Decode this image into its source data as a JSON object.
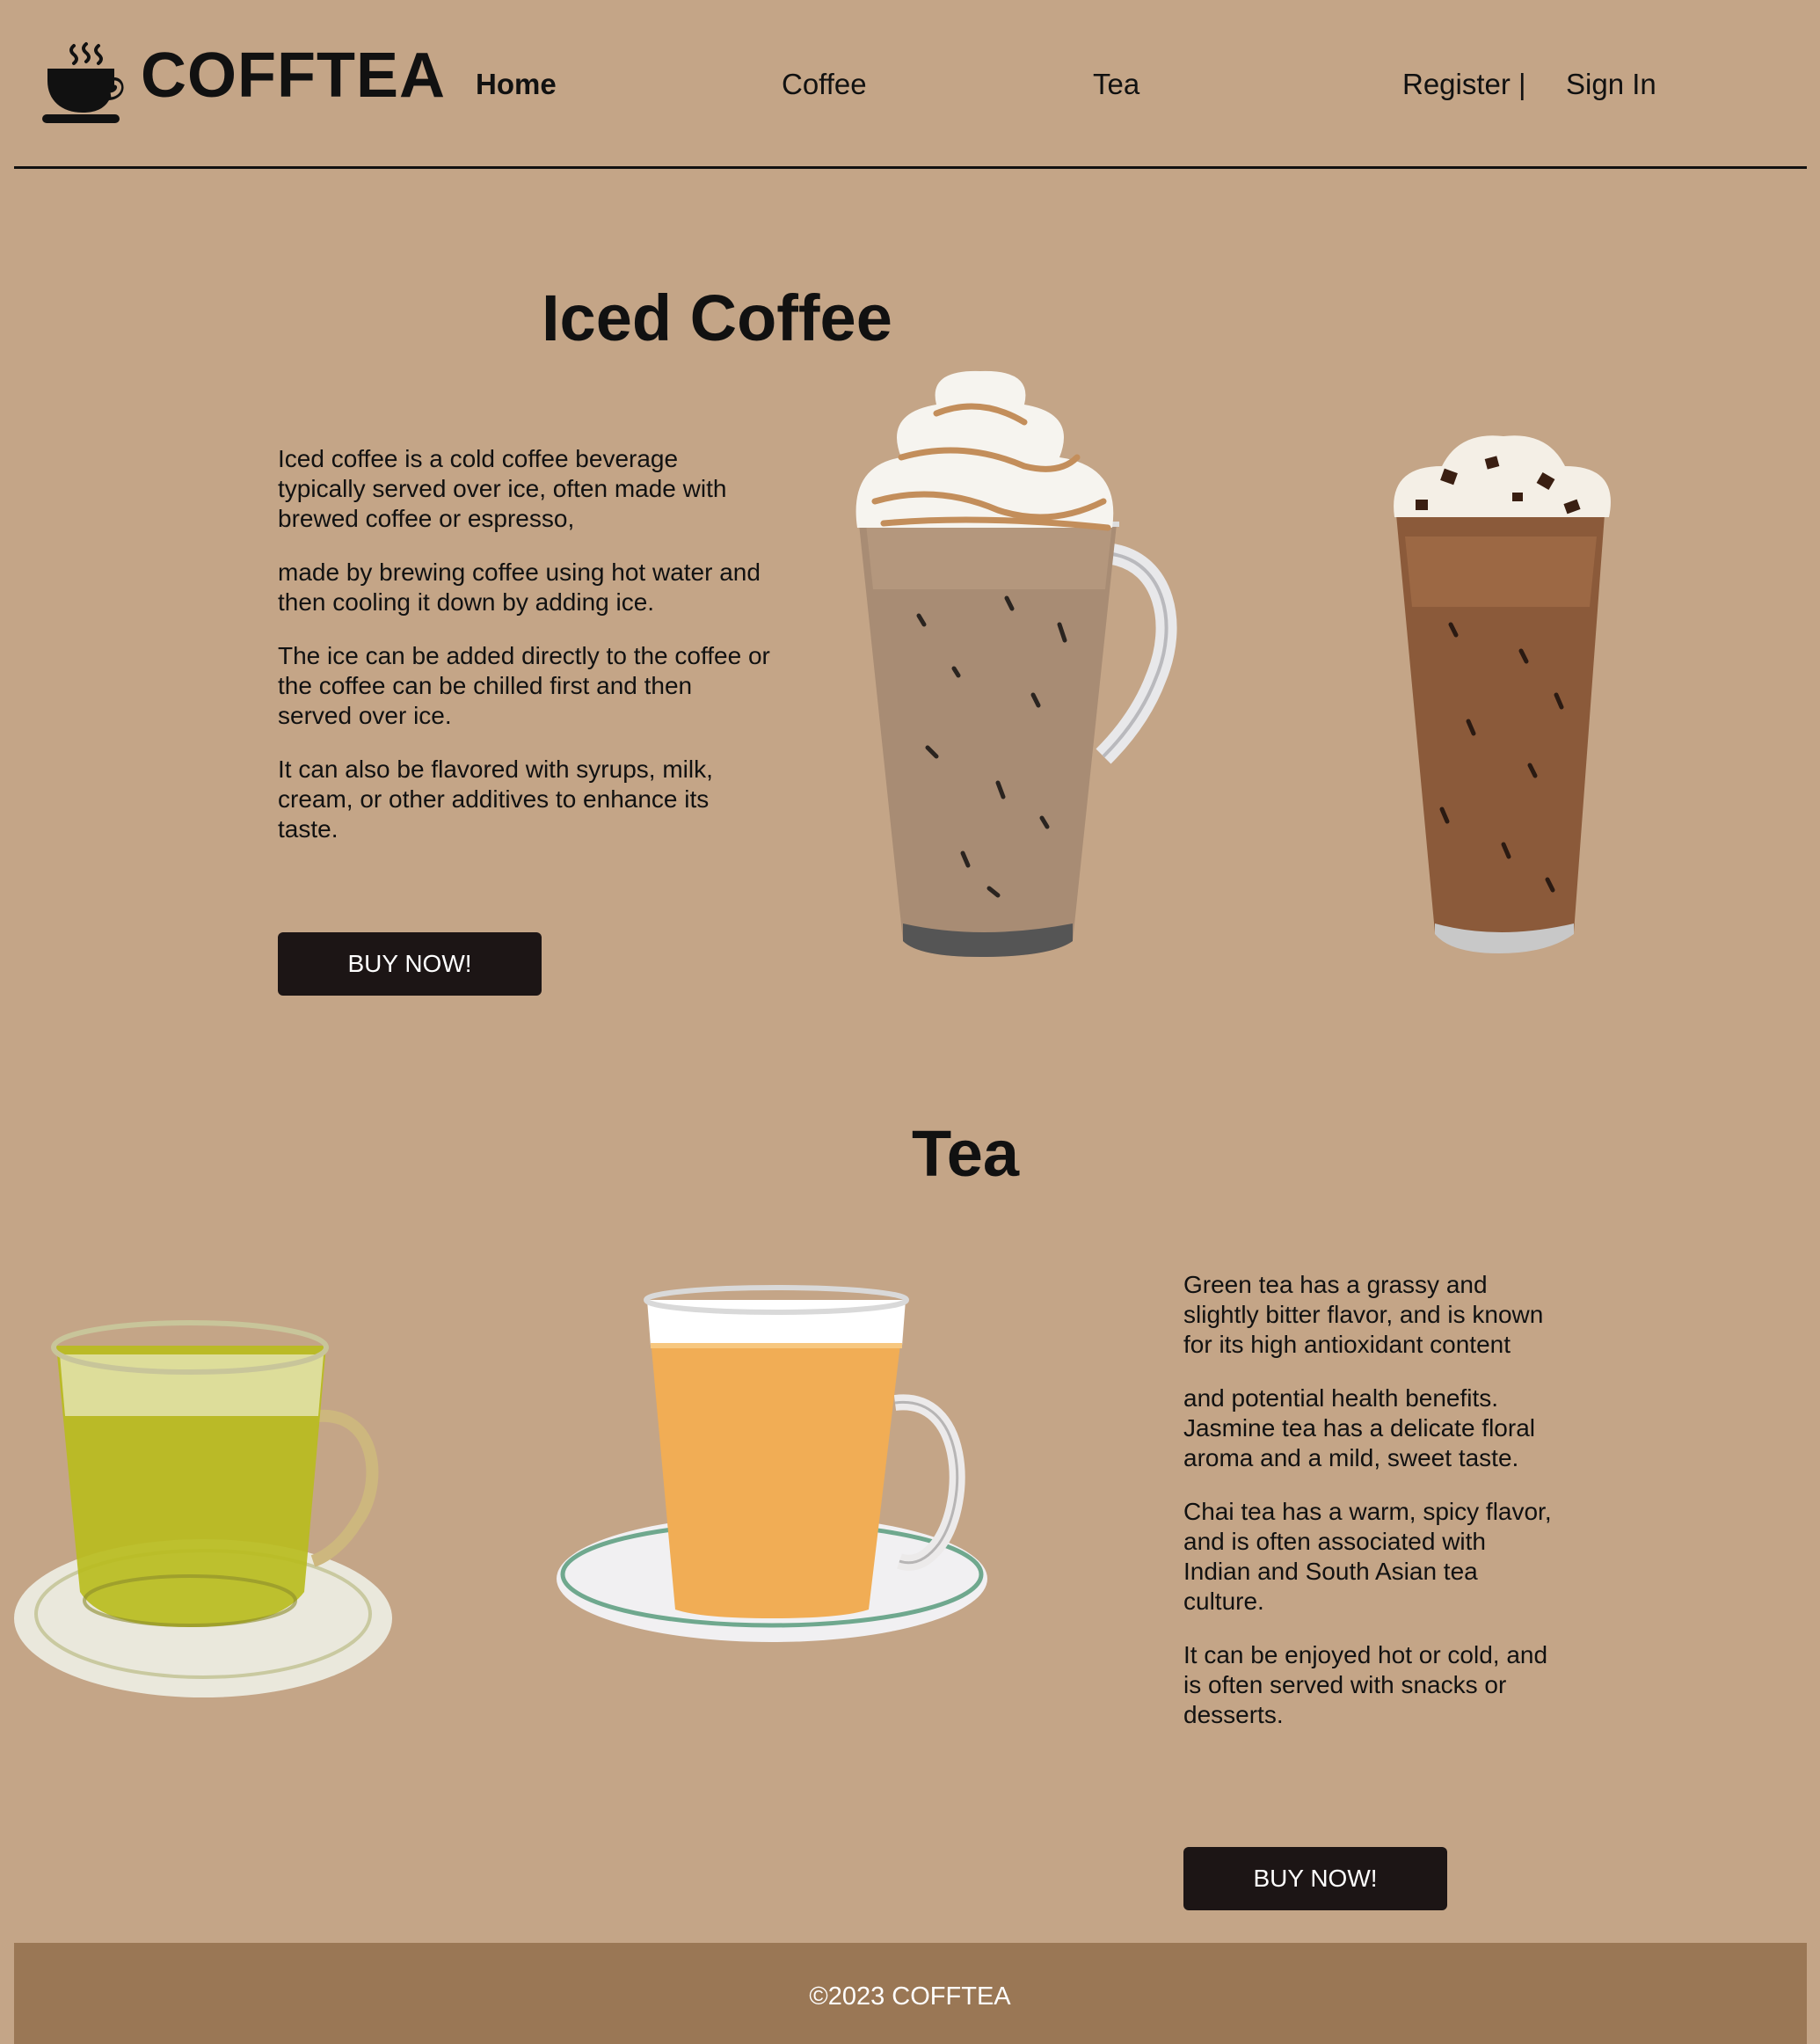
{
  "header": {
    "brand": "COFFTEA",
    "nav": {
      "home": "Home",
      "coffee": "Coffee",
      "tea": "Tea",
      "register": "Register |",
      "signin": "Sign In"
    }
  },
  "coffee_section": {
    "title": "Iced Coffee",
    "paragraphs": [
      "Iced coffee is a cold coffee beverage typically served over ice, often made with brewed coffee or espresso,",
      "made by brewing coffee using hot water and then cooling it down by adding ice.",
      "The ice can be added directly to the coffee or the coffee can be chilled first and then served over ice.",
      "It can also be flavored with syrups, milk, cream, or other additives to enhance its taste."
    ],
    "buy_label": "BUY NOW!"
  },
  "tea_section": {
    "title": "Tea",
    "paragraphs": [
      "Green tea has a grassy and slightly bitter flavor, and is known for its high antioxidant content",
      "and potential health benefits. Jasmine tea has a delicate floral aroma and a mild, sweet taste.",
      "Chai tea has a warm, spicy flavor, and is often associated with Indian and South Asian tea culture.",
      "It can be enjoyed hot or cold, and is often served with snacks or desserts."
    ],
    "buy_label": "BUY NOW!"
  },
  "footer": {
    "copyright": "©2023 COFFTEA"
  },
  "colors": {
    "background": "#c4a587",
    "footer": "#9a7755",
    "button": "#1c1515"
  }
}
